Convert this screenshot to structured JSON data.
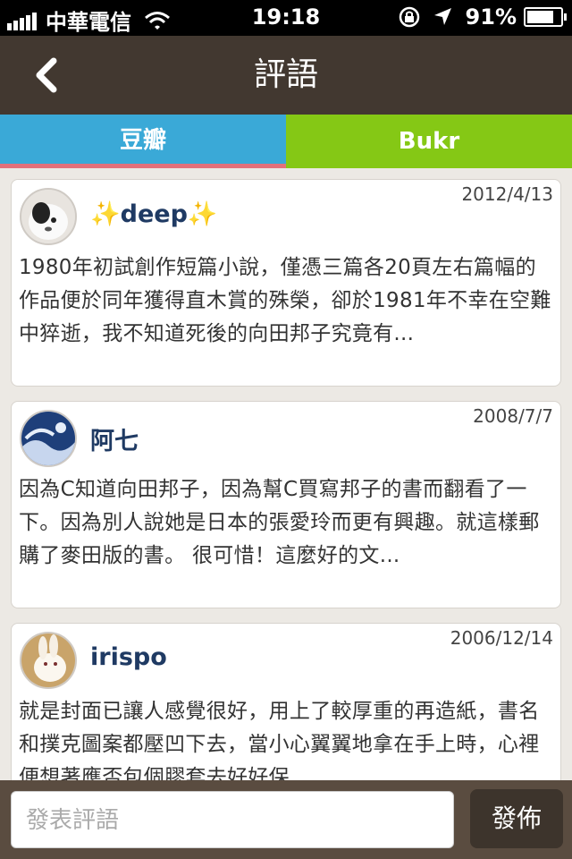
{
  "status_bar": {
    "carrier": "中華電信",
    "time": "19:18",
    "battery": "91%",
    "battery_level": 0.91
  },
  "nav": {
    "title": "評語",
    "back_icon": "chevron-left-icon"
  },
  "tabs": [
    {
      "label": "豆瓣",
      "color": "#3aa9d7"
    },
    {
      "label": "Bukr",
      "color": "#85c815"
    }
  ],
  "comments": [
    {
      "user": "✨deep✨",
      "date": "2012/4/13",
      "text": "1980年初試創作短篇小說，僅憑三篇各20頁左右篇幅的作品便於同年獲得直木賞的殊榮，卻於1981年不幸在空難中猝逝，我不知道死後的向田邦子究竟有..."
    },
    {
      "user": "阿七",
      "date": "2008/7/7",
      "text": "因為C知道向田邦子，因為幫C買寫邦子的書而翻看了一下。因為別人說她是日本的張愛玲而更有興趣。就這樣郵購了麥田版的書。 很可惜！這麼好的文..."
    },
    {
      "user": "irispo",
      "date": "2006/12/14",
      "text": "就是封面已讓人感覺很好，用上了較厚重的再造紙，書名和撲克圖案都壓凹下去，當小心翼翼地拿在手上時，心裡便想著應否包個膠套去好好保"
    }
  ],
  "composer": {
    "placeholder": "發表評語",
    "post_label": "發佈"
  },
  "colors": {
    "nav_bg": "#423830",
    "composer_bg": "#5a4c40",
    "username": "#1f3a63"
  }
}
